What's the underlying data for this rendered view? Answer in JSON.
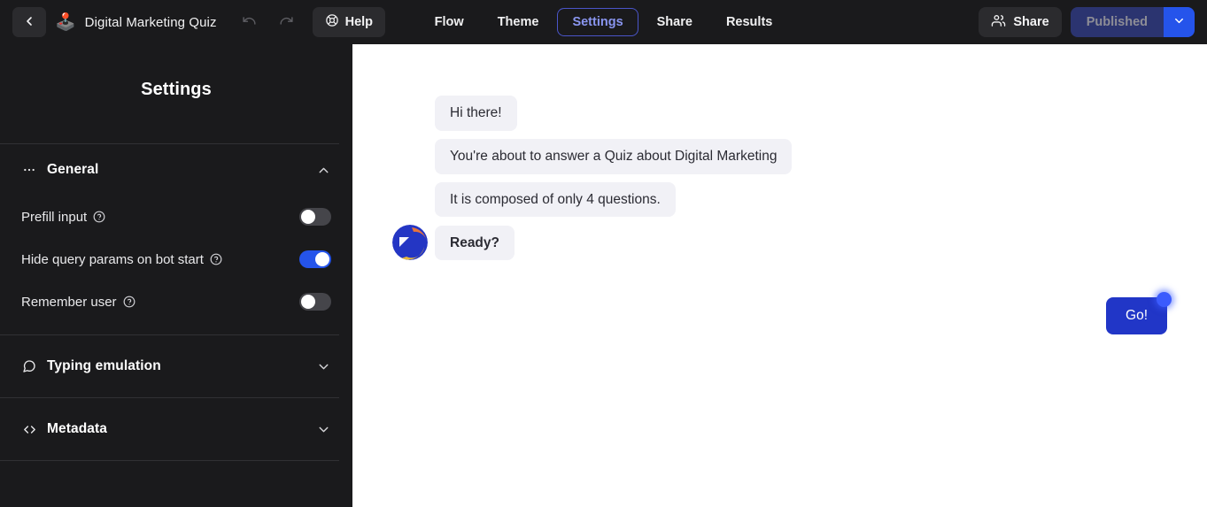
{
  "header": {
    "back_icon": "chevron-left-icon",
    "bot_emoji": "joystick-icon",
    "bot_name": "Digital Marketing Quiz",
    "undo_icon": "undo-icon",
    "redo_icon": "redo-icon",
    "help_label": "Help",
    "help_icon": "lifebuoy-icon",
    "tabs": [
      {
        "label": "Flow",
        "active": false
      },
      {
        "label": "Theme",
        "active": false
      },
      {
        "label": "Settings",
        "active": true
      },
      {
        "label": "Share",
        "active": false
      },
      {
        "label": "Results",
        "active": false
      }
    ],
    "share_label": "Share",
    "share_icon": "users-icon",
    "publish_label": "Published",
    "publish_caret_icon": "chevron-down-icon",
    "accent_blue": "#2554eb",
    "active_tab_border": "#4a55c9",
    "active_tab_text": "#8a96f0",
    "publish_bg": "#2b3470"
  },
  "sidebar": {
    "title": "Settings",
    "sections": [
      {
        "label": "General",
        "icon": "ellipsis-icon",
        "chevron": "chevron-up-icon",
        "expanded": true,
        "rows": [
          {
            "label": "Prefill input",
            "help_icon": "question-circle-icon",
            "toggle": "off"
          },
          {
            "label": "Hide query params on bot start",
            "help_icon": "question-circle-icon",
            "toggle": "on"
          },
          {
            "label": "Remember user",
            "help_icon": "question-circle-icon",
            "toggle": "off"
          }
        ]
      },
      {
        "label": "Typing emulation",
        "icon": "chat-bubble-icon",
        "chevron": "chevron-down-icon",
        "expanded": false,
        "rows": []
      },
      {
        "label": "Metadata",
        "icon": "code-icon",
        "chevron": "chevron-down-icon",
        "expanded": false,
        "rows": []
      }
    ]
  },
  "chat": {
    "messages": [
      {
        "text": "Hi there!",
        "bold": false,
        "avatar": false
      },
      {
        "text": "You're about to answer a Quiz about Digital Marketing",
        "bold": false,
        "avatar": false
      },
      {
        "text": "It is composed of only 4 questions.",
        "bold": false,
        "avatar": false
      },
      {
        "text": "Ready?",
        "bold": true,
        "avatar": true
      }
    ],
    "cta_label": "Go!",
    "bubble_bg": "#f1f1f6",
    "cta_bg": "#2136c7"
  }
}
